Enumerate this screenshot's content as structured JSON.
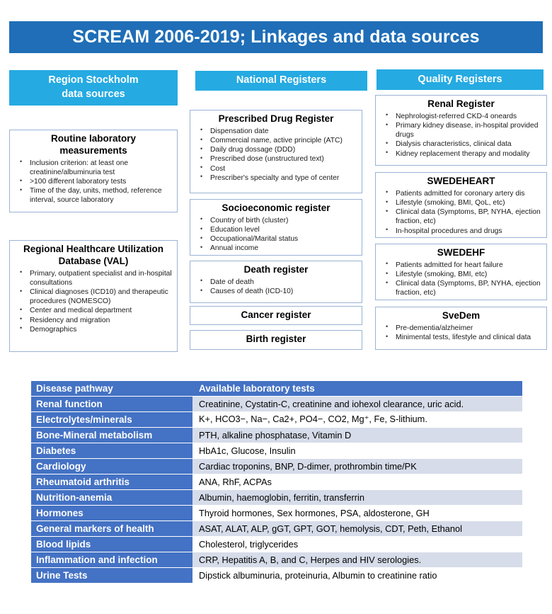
{
  "title": {
    "text": "SCREAM 2006-2019; Linkages and data sources",
    "bar_color": "#1F6EB7",
    "text_color": "#FFFFFF"
  },
  "theme": {
    "header_blue": "#25AAE2",
    "table_header_blue": "#4472C4",
    "table_row_shade": "#D6DCE9",
    "box_border": "#9BB3D4"
  },
  "columns": {
    "region": {
      "header": "Region Stockholm\ndata sources",
      "header_line1": "Region Stockholm",
      "header_line2": "data sources",
      "boxes": [
        {
          "title_line1": "Routine laboratory",
          "title_line2": "measurements",
          "bullets": [
            "Inclusion criterion: at least one creatinine/albuminuria test",
            ">100 different laboratory tests",
            "Time of the day, units, method, reference interval, source laboratory"
          ]
        },
        {
          "title_line1": "Regional Healthcare Utilization",
          "title_line2": "Database (VAL)",
          "bullets": [
            "Primary, outpatient specialist and in-hospital consultations",
            "Clinical diagnoses (ICD10) and therapeutic procedures (NOMESCO)",
            "Center and medical department",
            "Residency and migration",
            "Demographics"
          ]
        }
      ]
    },
    "national": {
      "header": "National Registers",
      "boxes": [
        {
          "title": "Prescribed Drug Register",
          "bullets": [
            "Dispensation date",
            "Commercial name, active principle (ATC)",
            "Daily drug dossage (DDD)",
            "Prescribed dose (unstructured text)",
            "Cost",
            "Prescriber's specialty and type of center"
          ]
        },
        {
          "title": "Socioeconomic register",
          "bullets": [
            "Country of birth (cluster)",
            "Education level",
            "Occupational/Marital status",
            "Annual income"
          ]
        },
        {
          "title": "Death register",
          "bullets": [
            "Date of death",
            "Causes of death (ICD-10)"
          ]
        },
        {
          "title": "Cancer register",
          "bullets": []
        },
        {
          "title": "Birth register",
          "bullets": []
        }
      ]
    },
    "quality": {
      "header": "Quality Registers",
      "boxes": [
        {
          "title": "Renal Register",
          "bullets": [
            "Nephrologist-referred CKD-4 oneards",
            "Primary kidney disease, in-hospital provided drugs",
            "Dialysis characteristics, clinical data",
            "Kidney replacement therapy and modality"
          ]
        },
        {
          "title": "SWEDEHEART",
          "bullets": [
            "Patients admitted for coronary artery dis",
            "Lifestyle (smoking, BMI, QoL, etc)",
            "Clinical data (Symptoms, BP, NYHA, ejection fraction, etc)",
            "In-hospital procedures and drugs"
          ]
        },
        {
          "title": "SWEDEHF",
          "bullets": [
            "Patients admitted for heart failure",
            "Lifestyle (smoking, BMI, etc)",
            "Clinical data (Symptoms, BP, NYHA, ejection fraction, etc)"
          ]
        },
        {
          "title": "SveDem",
          "bullets": [
            "Pre-dementia/alzheimer",
            "Minimental tests, lifestyle and clinical data"
          ]
        }
      ]
    }
  },
  "lab_table": {
    "headers": [
      "Disease pathway",
      "Available laboratory tests"
    ],
    "rows": [
      [
        "Renal function",
        "Creatinine, Cystatin-C, creatinine and  iohexol clearance, uric acid."
      ],
      [
        "Electrolytes/minerals",
        "K+, HCO3−, Na−, Ca2+, PO4−, CO2, Mg⁺, Fe, S-lithium."
      ],
      [
        "Bone-Mineral metabolism",
        "PTH, alkaline phosphatase, Vitamin D"
      ],
      [
        "Diabetes",
        "HbA1c, Glucose, Insulin"
      ],
      [
        "Cardiology",
        "Cardiac troponins, BNP, D-dimer, prothrombin time/PK"
      ],
      [
        "Rheumatoid arthritis",
        "ANA, RhF, ACPAs"
      ],
      [
        "Nutrition-anemia",
        "Albumin, haemoglobin, ferritin, transferrin"
      ],
      [
        "Hormones",
        "Thyroid hormones, Sex hormones, PSA, aldosterone, GH"
      ],
      [
        "General markers of health",
        "ASAT, ALAT, ALP, gGT, GPT, GOT, hemolysis, CDT, Peth, Ethanol"
      ],
      [
        "Blood  lipids",
        "Cholesterol, triglycerides"
      ],
      [
        "Inflammation and infection",
        "CRP, Hepatitis A, B, and C, Herpes and HIV serologies."
      ],
      [
        "Urine Tests",
        "Dipstick albuminuria, proteinuria, Albumin to creatinine ratio"
      ]
    ]
  }
}
